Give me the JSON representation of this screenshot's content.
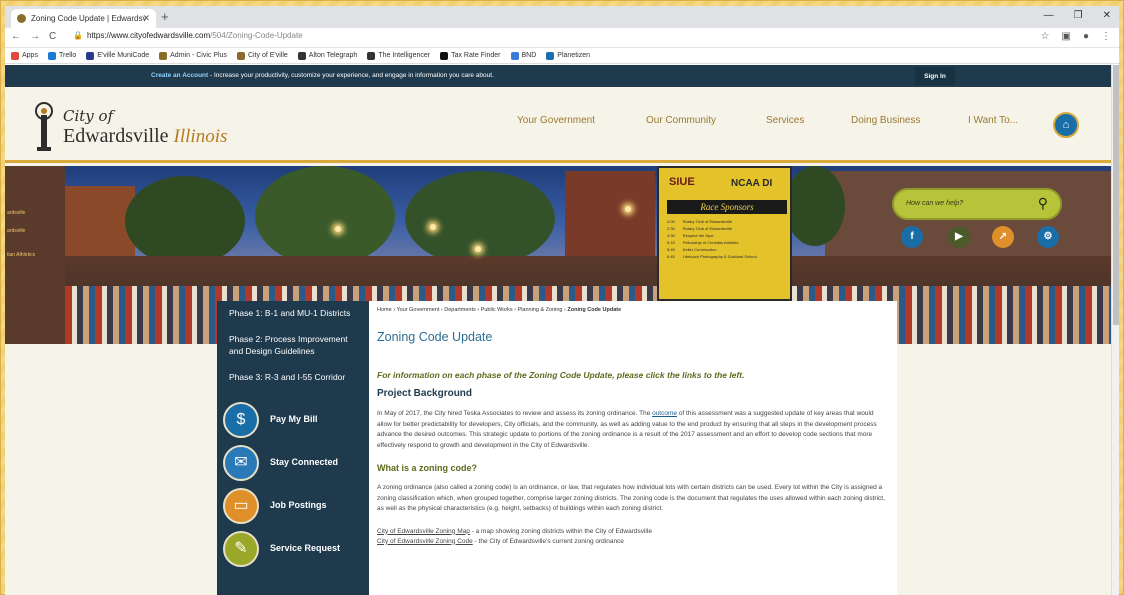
{
  "browser": {
    "tab_title": "Zoning Code Update | Edwardsv",
    "url_host": "https://www.cityofedwardsville.com",
    "url_path": "/504/Zoning-Code-Update",
    "bookmarks": [
      "Apps",
      "Trello",
      "E'ville MuniCode",
      "Admin - Civic Plus",
      "City of E'ville",
      "Alton Telegraph",
      "The Intelligencer",
      "Tax Rate Finder",
      "BND",
      "Planetizen"
    ],
    "bookmark_colors": [
      "#e14a3b",
      "#1b7bd1",
      "#2a3a8a",
      "#8a6d2a",
      "#8a6d2a",
      "#333333",
      "#333333",
      "#111111",
      "#3a7bd5",
      "#1b6fb0"
    ]
  },
  "topbar": {
    "create_account": "Create an Account",
    "message": " - Increase your productivity, customize your experience, and engage in information you care about.",
    "sign_in": "Sign In"
  },
  "logo": {
    "city": "City of",
    "name": "Edwardsville",
    "state": "Illinois"
  },
  "nav": [
    "Your Government",
    "Our Community",
    "Services",
    "Doing Business",
    "I Want To..."
  ],
  "banner": {
    "search_placeholder": "How can we help?",
    "sponsor_siue": "SIUE",
    "sponsor_ncaa": "NCAA DI",
    "sponsor_title": "Race Sponsors",
    "sponsor_rows": [
      [
        "2:00",
        "Rotary Club of Edwardsville"
      ],
      [
        "2:30",
        "Rotary Club of Edwardsville"
      ],
      [
        "4:30",
        "Respect the Spot"
      ],
      [
        "5:15",
        "Fellowship of Christian Athletes"
      ],
      [
        "5:45",
        "Keller Construction"
      ],
      [
        "6:45",
        "Lifetouch Photography & Goddard School"
      ]
    ],
    "left_edge": [
      "ardsville",
      "ardsville",
      "tian Athletics"
    ]
  },
  "sidebar": {
    "phases": [
      "Phase 1: B-1 and MU-1 Districts",
      "Phase 2: Process Improvement and Design Guidelines",
      "Phase 3: R-3 and I-55 Corridor"
    ],
    "quick_links": [
      {
        "label": "Pay My Bill",
        "icon": "dollar-icon",
        "color": "#1a6ea8"
      },
      {
        "label": "Stay Connected",
        "icon": "envelope-icon",
        "color": "#2a7ab8"
      },
      {
        "label": "Job Postings",
        "icon": "briefcase-icon",
        "color": "#e0902a"
      },
      {
        "label": "Service Request",
        "icon": "wrench-icon",
        "color": "#9aa82a"
      }
    ]
  },
  "content": {
    "breadcrumb": [
      "Home",
      "Your Government",
      "Departments",
      "Public Works",
      "Planning & Zoning"
    ],
    "breadcrumb_current": "Zoning Code Update",
    "title": "Zoning Code Update",
    "intro": "For information on each phase of the Zoning Code Update, please click the links to the left.",
    "h_background": "Project Background",
    "p1_a": "In May of 2017, the City hired Teska Associates to review and assess its zoning ordinance. The ",
    "p1_link": "outcome",
    "p1_b": " of this assessment was a suggested update of key areas that would allow for better predictability for developers, City officials, and the community, as well as adding value to the end product by ensuring that all steps in the development process advance the desired outcomes. This strategic update to portions of the zoning ordinance is a result of the 2017 assessment and an effort to develop code sections that more effectively respond to growth and development in the City of Edwardsville.",
    "h_what": "What is a zoning code?",
    "p2": "A zoning ordinance (also called a zoning code) is an ordinance, or law, that regulates how individual lots with certain districts can be used. Every lot within the City is assigned a zoning classification which, when grouped together, comprise larger zoning districts. The zoning code is the document that regulates the uses allowed within each zoning district, as well as the physical characteristics (e.g. height, setbacks) of buildings within each zoning district.",
    "link1": "City of Edwardsville Zoning Map",
    "link1_desc": " - a map showing zoning districts within the City of Edwardsville",
    "link2": "City of Edwardsville Zoning Code",
    "link2_desc": " - the City of Edwardsville's current zoning ordinance"
  }
}
